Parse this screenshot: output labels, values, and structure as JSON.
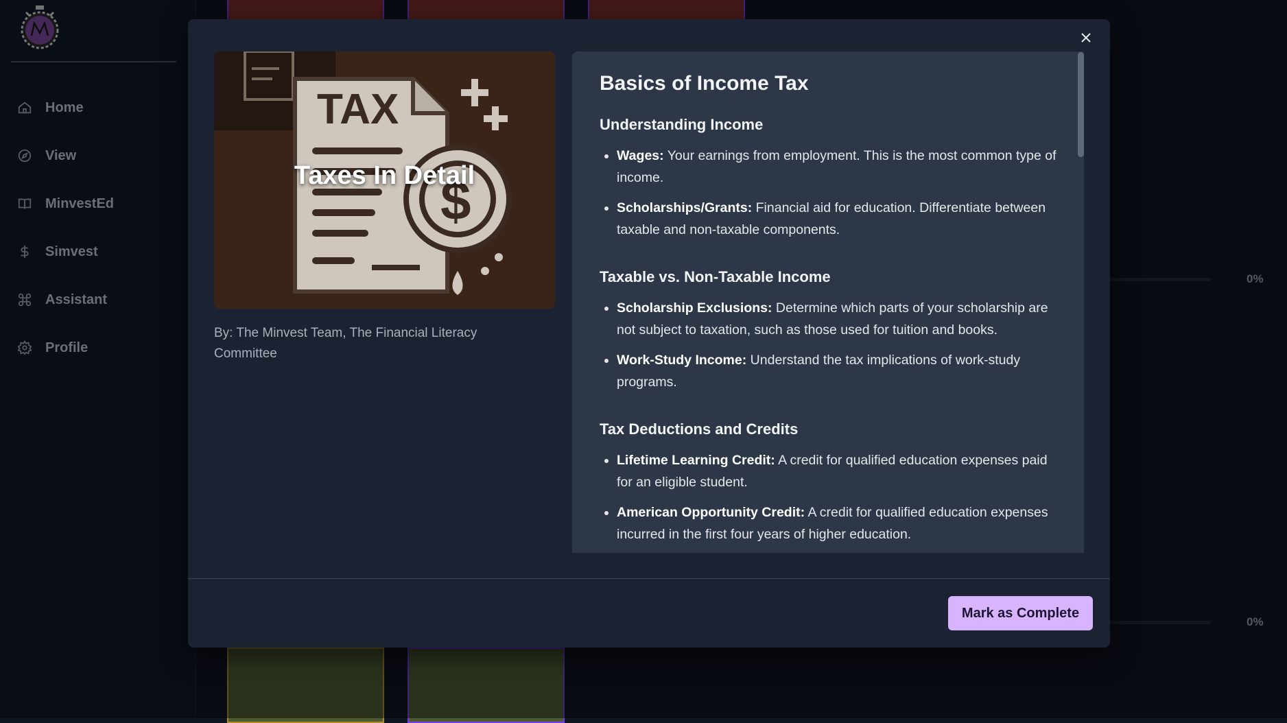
{
  "sidebar": {
    "logo_icon": "minvest-stopwatch-logo",
    "items": [
      {
        "label": "Home",
        "icon": "home-icon"
      },
      {
        "label": "View",
        "icon": "compass-icon"
      },
      {
        "label": "MinvestEd",
        "icon": "book-icon"
      },
      {
        "label": "Simvest",
        "icon": "dollar-icon"
      },
      {
        "label": "Assistant",
        "icon": "command-icon"
      },
      {
        "label": "Profile",
        "icon": "gear-icon"
      }
    ]
  },
  "background": {
    "progress_top": "0%",
    "progress_bottom": "0%"
  },
  "modal": {
    "hero_title": "Taxes In Detail",
    "hero_image": "tax-document-illustration",
    "authors": "By: The Minvest Team, The Financial Literacy Committee",
    "article_title": "Basics of Income Tax",
    "sections": [
      {
        "heading": "Understanding Income",
        "items": [
          {
            "term": "Wages:",
            "text": " Your earnings from employment. This is the most common type of income."
          },
          {
            "term": "Scholarships/Grants:",
            "text": " Financial aid for education. Differentiate between taxable and non-taxable components."
          }
        ]
      },
      {
        "heading": "Taxable vs. Non-Taxable Income",
        "items": [
          {
            "term": "Scholarship Exclusions:",
            "text": " Determine which parts of your scholarship are not subject to taxation, such as those used for tuition and books."
          },
          {
            "term": "Work-Study Income:",
            "text": " Understand the tax implications of work-study programs."
          }
        ]
      },
      {
        "heading": "Tax Deductions and Credits",
        "items": [
          {
            "term": "Lifetime Learning Credit:",
            "text": " A credit for qualified education expenses paid for an eligible student."
          },
          {
            "term": "American Opportunity Credit:",
            "text": " A credit for qualified education expenses incurred in the first four years of higher education."
          }
        ]
      }
    ],
    "complete_button": "Mark as Complete"
  },
  "colors": {
    "accent": "#d8b4fe",
    "modal_bg": "#1b2232",
    "panel_bg": "#2d3748",
    "sidebar_bg": "#111827"
  }
}
